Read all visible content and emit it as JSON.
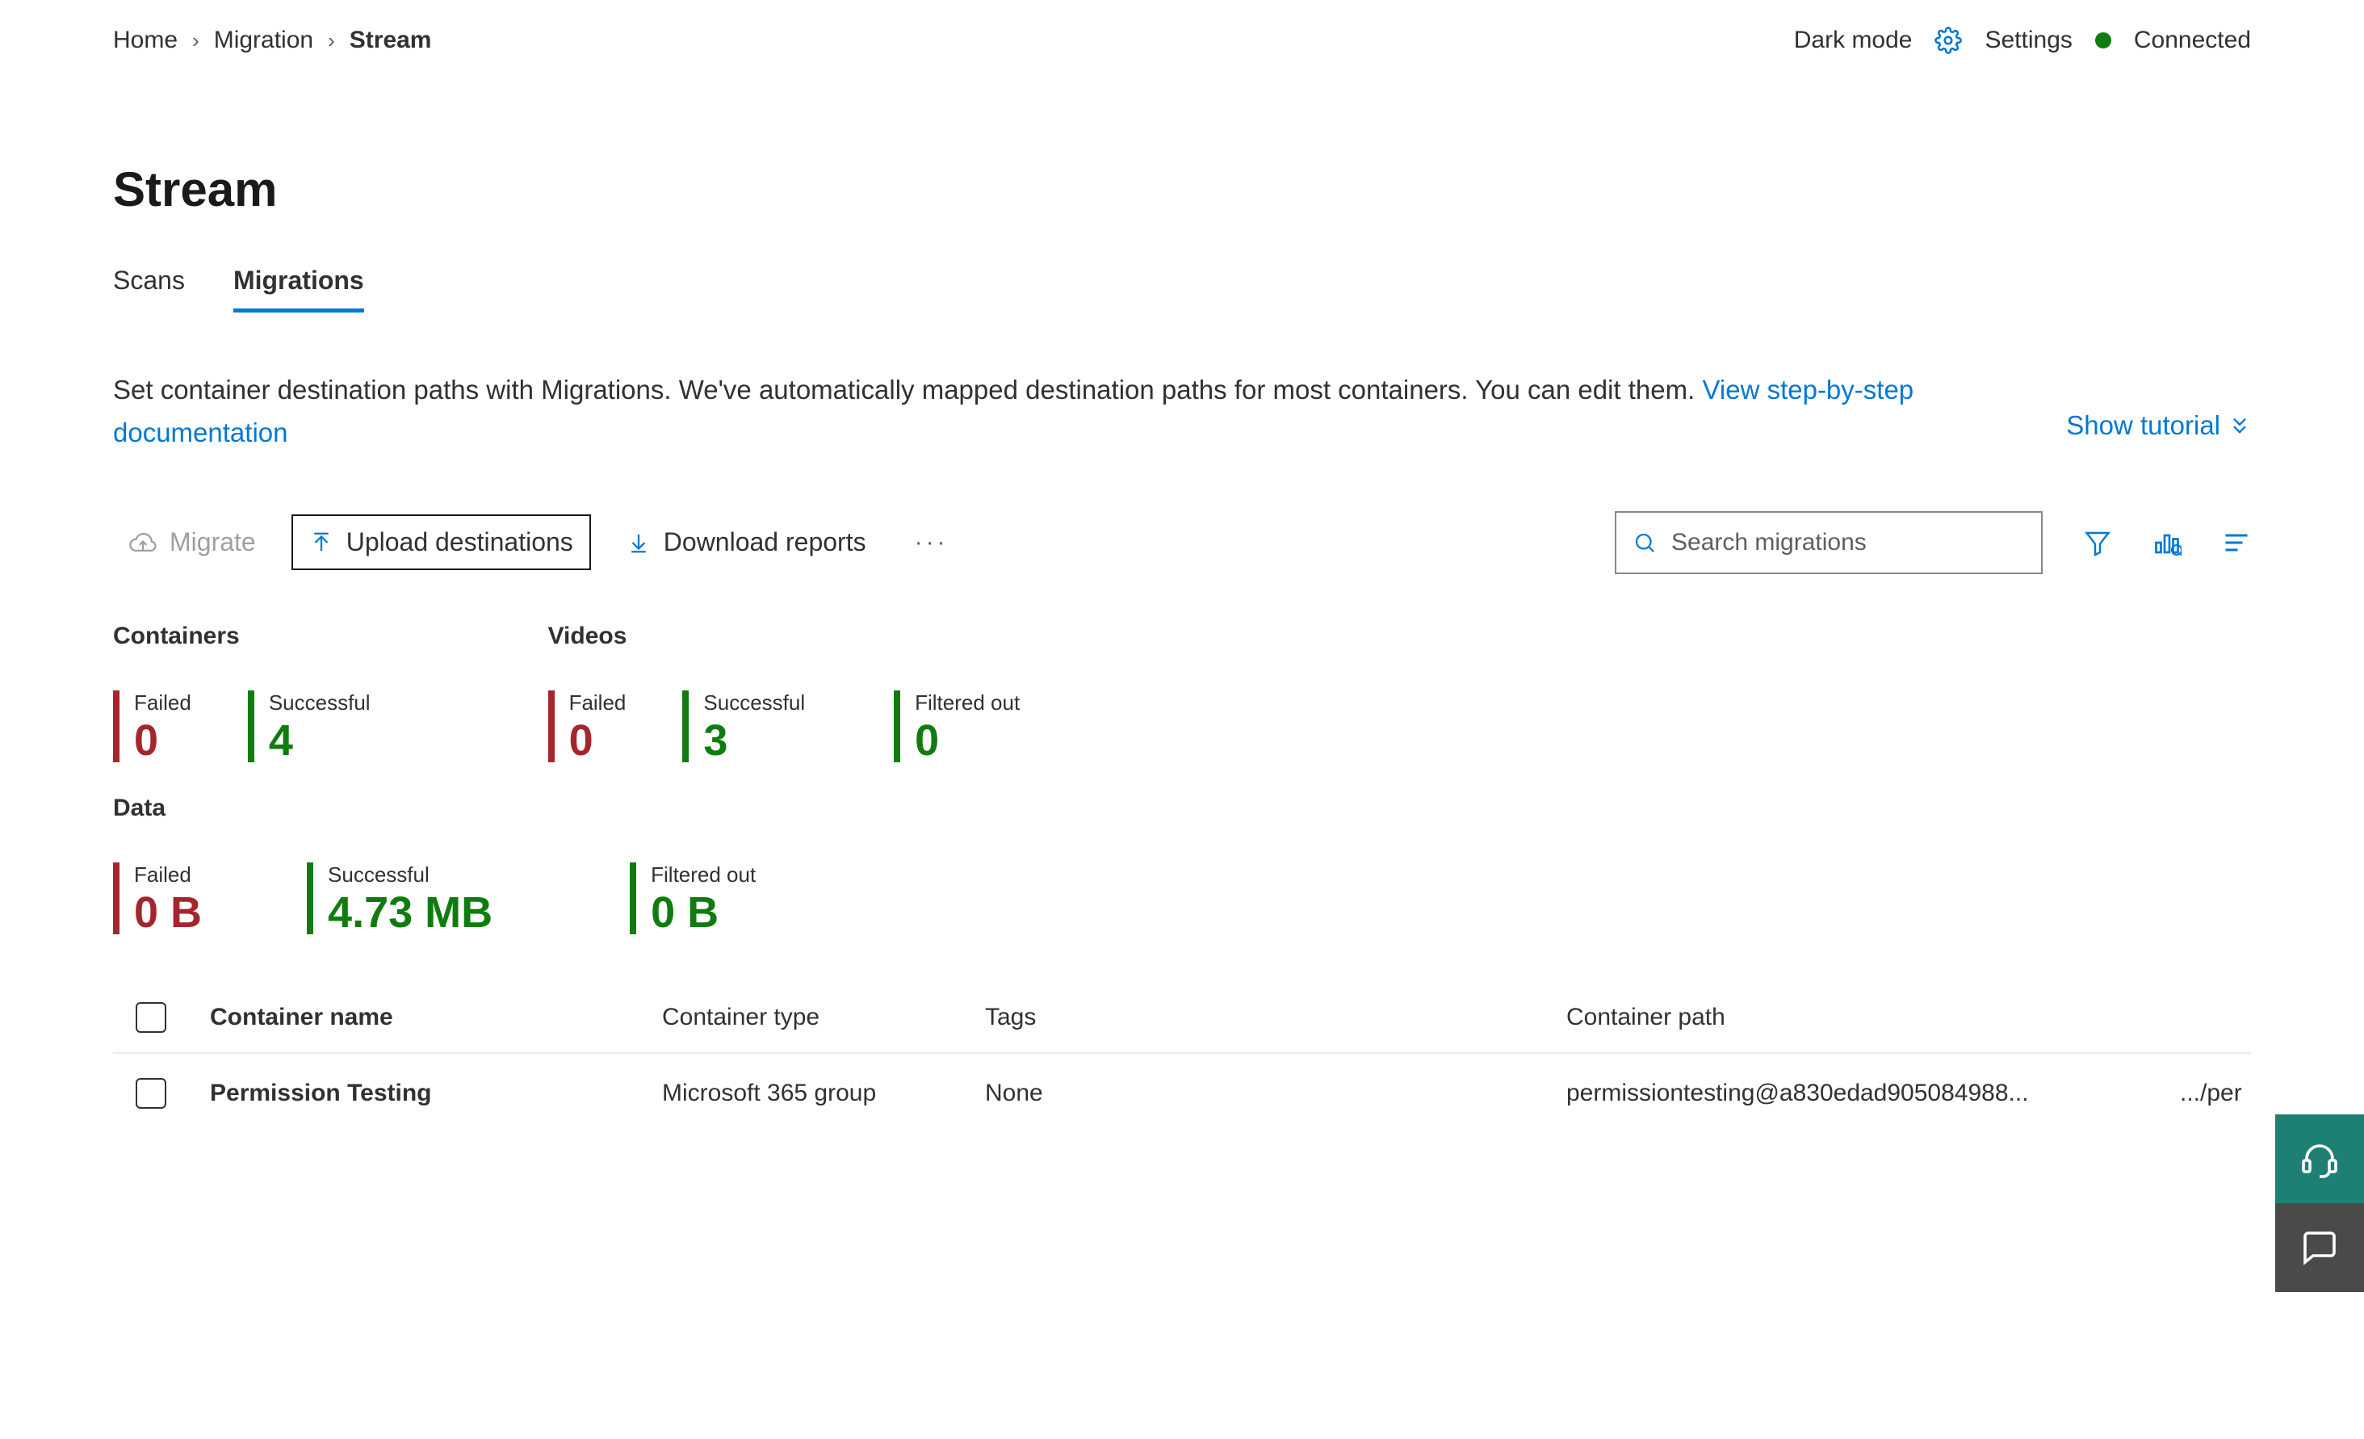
{
  "breadcrumb": {
    "items": [
      "Home",
      "Migration",
      "Stream"
    ]
  },
  "header": {
    "darkmode": "Dark mode",
    "settings": "Settings",
    "connected": "Connected"
  },
  "page_title": "Stream",
  "tabs": {
    "scans": "Scans",
    "migrations": "Migrations"
  },
  "desc": {
    "text_a": "Set container destination paths with Migrations. We've automatically mapped destination paths for most containers. You can edit them. ",
    "link": "View step-by-step documentation",
    "show_tutorial": "Show tutorial"
  },
  "commands": {
    "migrate": "Migrate",
    "upload": "Upload destinations",
    "download": "Download reports",
    "search_placeholder": "Search migrations"
  },
  "stats": {
    "containers": {
      "title": "Containers",
      "failed_label": "Failed",
      "failed_value": "0",
      "success_label": "Successful",
      "success_value": "4"
    },
    "videos": {
      "title": "Videos",
      "failed_label": "Failed",
      "failed_value": "0",
      "success_label": "Successful",
      "success_value": "3",
      "filtered_label": "Filtered out",
      "filtered_value": "0"
    },
    "data": {
      "title": "Data",
      "failed_label": "Failed",
      "failed_value": "0 B",
      "success_label": "Successful",
      "success_value": "4.73 MB",
      "filtered_label": "Filtered out",
      "filtered_value": "0 B"
    }
  },
  "table": {
    "headers": {
      "name": "Container name",
      "type": "Container type",
      "tags": "Tags",
      "path": "Container path",
      "dest": ""
    },
    "rows": [
      {
        "name": "Permission Testing",
        "type": "Microsoft 365 group",
        "tags": "None",
        "path": "permissiontesting@a830edad905084988...",
        "dest": ".../per"
      }
    ]
  }
}
